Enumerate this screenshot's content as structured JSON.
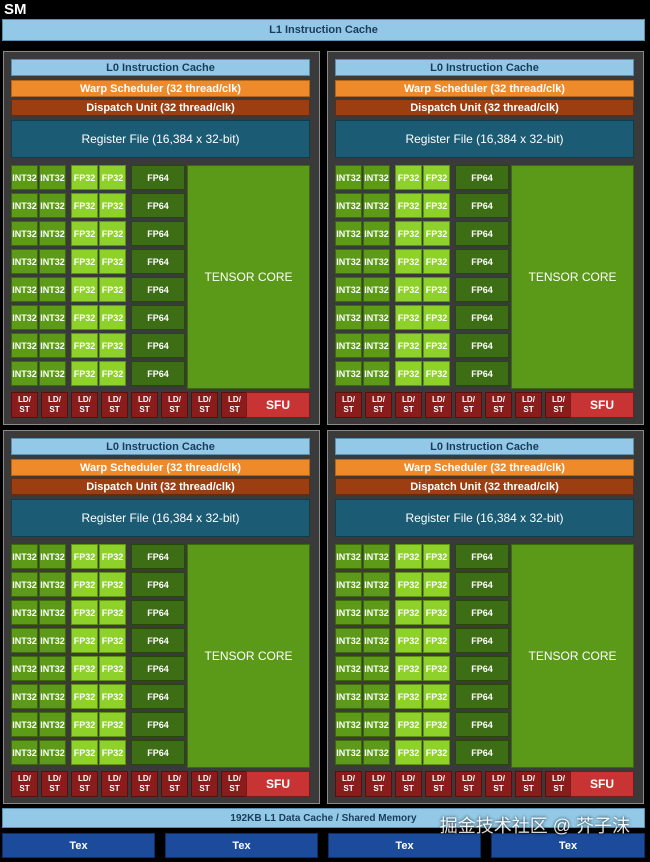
{
  "title": "SM",
  "l1_instruction_cache": "L1 Instruction Cache",
  "partition": {
    "l0_cache": "L0 Instruction Cache",
    "warp_scheduler": "Warp Scheduler (32 thread/clk)",
    "dispatch_unit": "Dispatch Unit (32 thread/clk)",
    "register_file": "Register File (16,384 x 32-bit)",
    "int32_label": "INT32",
    "fp32_label": "FP32",
    "fp64_label": "FP64",
    "tensor_core": "TENSOR CORE",
    "ldst_label": "LD/ ST",
    "sfu_label": "SFU"
  },
  "l1_data_cache": "192KB L1 Data Cache / Shared Memory",
  "tex_label": "Tex",
  "watermark": "掘金技术社区 @ 芥子沫"
}
